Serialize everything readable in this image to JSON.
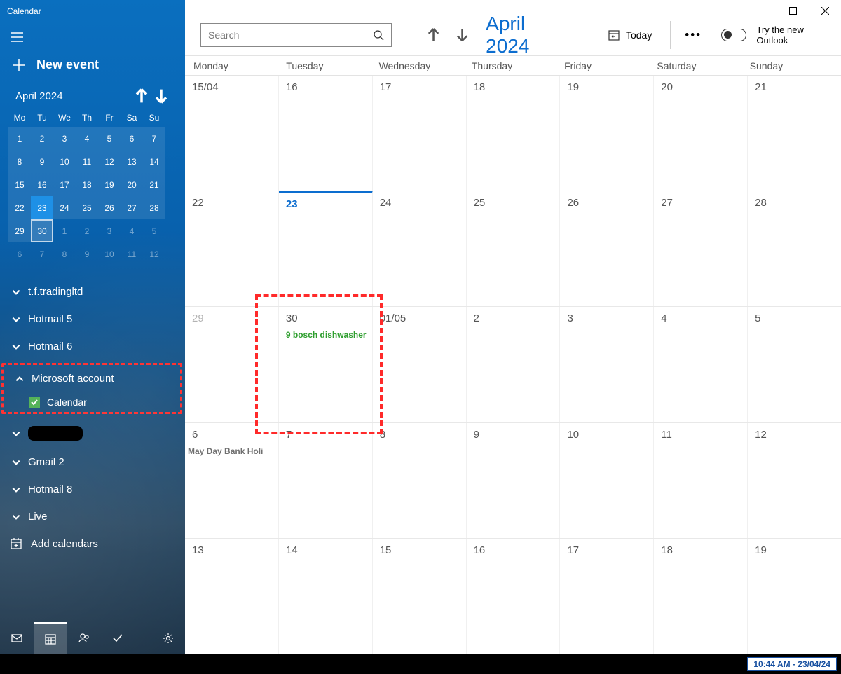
{
  "app_title": "Calendar",
  "new_event": "New event",
  "mini": {
    "label": "April 2024",
    "heads": [
      "Mo",
      "Tu",
      "We",
      "Th",
      "Fr",
      "Sa",
      "Su"
    ],
    "rows": [
      [
        {
          "n": "1",
          "in": true
        },
        {
          "n": "2",
          "in": true
        },
        {
          "n": "3",
          "in": true
        },
        {
          "n": "4",
          "in": true
        },
        {
          "n": "5",
          "in": true
        },
        {
          "n": "6",
          "in": true
        },
        {
          "n": "7",
          "in": true
        }
      ],
      [
        {
          "n": "8",
          "in": true
        },
        {
          "n": "9",
          "in": true
        },
        {
          "n": "10",
          "in": true
        },
        {
          "n": "11",
          "in": true
        },
        {
          "n": "12",
          "in": true
        },
        {
          "n": "13",
          "in": true
        },
        {
          "n": "14",
          "in": true
        }
      ],
      [
        {
          "n": "15",
          "in": true
        },
        {
          "n": "16",
          "in": true
        },
        {
          "n": "17",
          "in": true
        },
        {
          "n": "18",
          "in": true
        },
        {
          "n": "19",
          "in": true
        },
        {
          "n": "20",
          "in": true
        },
        {
          "n": "21",
          "in": true
        }
      ],
      [
        {
          "n": "22",
          "in": true
        },
        {
          "n": "23",
          "in": true,
          "today": true
        },
        {
          "n": "24",
          "in": true
        },
        {
          "n": "25",
          "in": true
        },
        {
          "n": "26",
          "in": true
        },
        {
          "n": "27",
          "in": true
        },
        {
          "n": "28",
          "in": true
        }
      ],
      [
        {
          "n": "29",
          "in": true
        },
        {
          "n": "30",
          "in": true,
          "sel": true
        },
        {
          "n": "1"
        },
        {
          "n": "2"
        },
        {
          "n": "3"
        },
        {
          "n": "4"
        },
        {
          "n": "5"
        }
      ],
      [
        {
          "n": "6"
        },
        {
          "n": "7"
        },
        {
          "n": "8"
        },
        {
          "n": "9"
        },
        {
          "n": "10"
        },
        {
          "n": "11"
        },
        {
          "n": "12"
        }
      ]
    ]
  },
  "accounts": {
    "a1": "t.f.tradingltd",
    "a2": "Hotmail 5",
    "a3": "Hotmail 6",
    "a4": "Microsoft account",
    "a4_sub": "Calendar",
    "a5": "redacted",
    "a6": "Gmail 2",
    "a7": "Hotmail 8",
    "a8": "Live"
  },
  "add_calendars": "Add calendars",
  "toolbar": {
    "search_placeholder": "Search",
    "month": "April 2024",
    "today": "Today",
    "try": "Try the new Outlook"
  },
  "dayheads": [
    "Monday",
    "Tuesday",
    "Wednesday",
    "Thursday",
    "Friday",
    "Saturday",
    "Sunday"
  ],
  "weeks": [
    [
      {
        "n": "15/04"
      },
      {
        "n": "16"
      },
      {
        "n": "17"
      },
      {
        "n": "18"
      },
      {
        "n": "19"
      },
      {
        "n": "20"
      },
      {
        "n": "21"
      }
    ],
    [
      {
        "n": "22"
      },
      {
        "n": "23",
        "today": true
      },
      {
        "n": "24"
      },
      {
        "n": "25"
      },
      {
        "n": "26"
      },
      {
        "n": "27"
      },
      {
        "n": "28"
      }
    ],
    [
      {
        "n": "29",
        "dim": true
      },
      {
        "n": "30",
        "ev": "9 bosch dishwasher",
        "evc": "green"
      },
      {
        "n": "01/05"
      },
      {
        "n": "2"
      },
      {
        "n": "3"
      },
      {
        "n": "4"
      },
      {
        "n": "5"
      }
    ],
    [
      {
        "n": "6",
        "ev": "May Day Bank Holi",
        "evc": "gray"
      },
      {
        "n": "7"
      },
      {
        "n": "8"
      },
      {
        "n": "9"
      },
      {
        "n": "10"
      },
      {
        "n": "11"
      },
      {
        "n": "12"
      }
    ],
    [
      {
        "n": "13"
      },
      {
        "n": "14"
      },
      {
        "n": "15"
      },
      {
        "n": "16"
      },
      {
        "n": "17"
      },
      {
        "n": "18"
      },
      {
        "n": "19"
      }
    ]
  ],
  "clock": "10:44 AM - 23/04/24"
}
